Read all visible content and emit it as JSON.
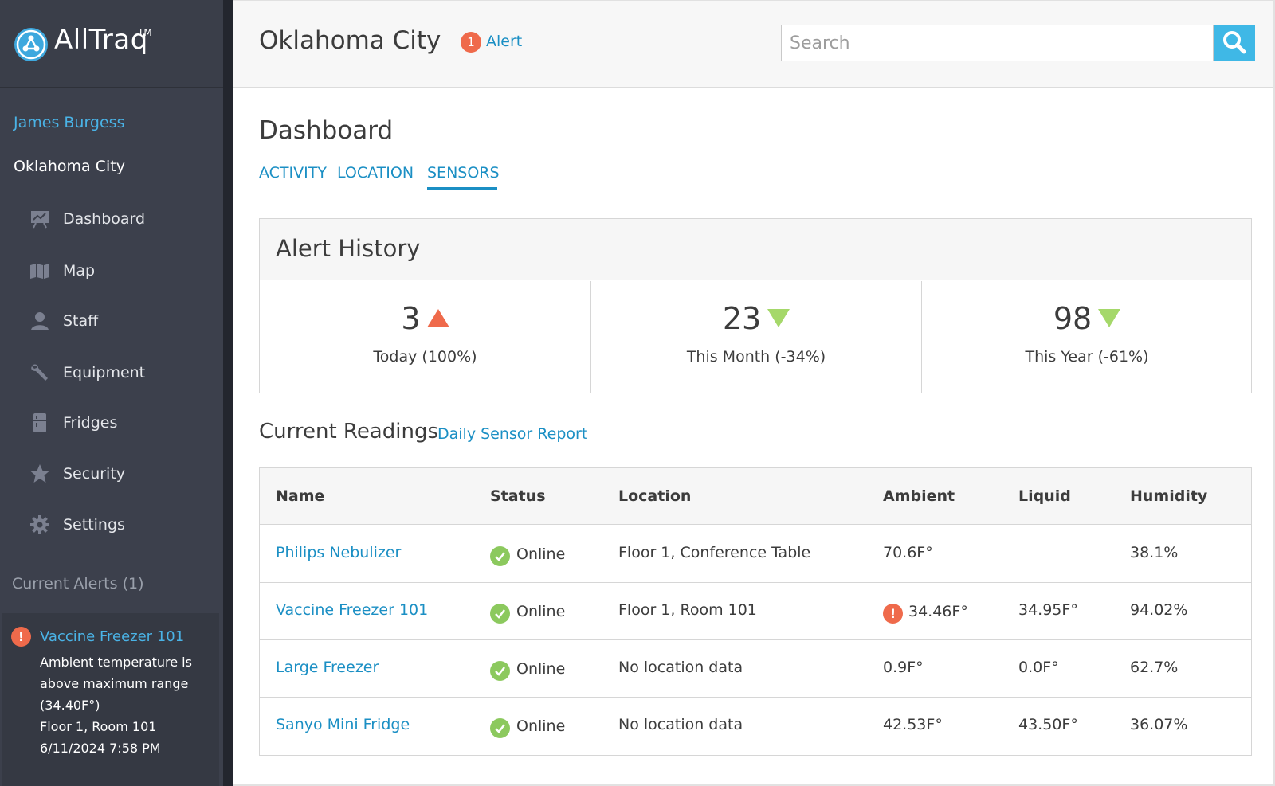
{
  "brand": {
    "name": "AllTraq",
    "tm": "TM",
    "icon": "alltraq-logo-icon"
  },
  "user": {
    "name": "James Burgess",
    "location": "Oklahoma City"
  },
  "nav": [
    {
      "label": "Dashboard",
      "icon": "dashboard-icon"
    },
    {
      "label": "Map",
      "icon": "map-icon"
    },
    {
      "label": "Staff",
      "icon": "person-icon"
    },
    {
      "label": "Equipment",
      "icon": "wrench-icon"
    },
    {
      "label": "Fridges",
      "icon": "fridge-icon"
    },
    {
      "label": "Security",
      "icon": "star-icon"
    },
    {
      "label": "Settings",
      "icon": "gear-icon"
    }
  ],
  "alerts_panel": {
    "title": "Current Alerts (1)",
    "items": [
      {
        "name": "Vaccine Freezer 101",
        "lines": [
          "Ambient temperature is",
          "above maximum range",
          "(34.40F°)",
          "Floor 1, Room 101",
          "6/11/2024 7:58 PM"
        ]
      }
    ]
  },
  "header": {
    "title": "Oklahoma City",
    "alert_count": "1",
    "alert_label": "Alert",
    "search_placeholder": "Search"
  },
  "dashboard": {
    "title": "Dashboard",
    "tabs": [
      "ACTIVITY",
      "LOCATION",
      "SENSORS"
    ],
    "active_tab": "SENSORS"
  },
  "alert_history": {
    "title": "Alert History",
    "stats": [
      {
        "value": "3",
        "trend": "up",
        "label": "Today (100%)"
      },
      {
        "value": "23",
        "trend": "down",
        "label": "This Month (-34%)"
      },
      {
        "value": "98",
        "trend": "down",
        "label": "This Year (-61%)"
      }
    ]
  },
  "readings": {
    "title": "Current Readings",
    "link": "Daily Sensor Report",
    "columns": [
      "Name",
      "Status",
      "Location",
      "Ambient",
      "Liquid",
      "Humidity"
    ],
    "rows": [
      {
        "name": "Philips Nebulizer",
        "status": "Online",
        "location": "Floor 1, Conference Table",
        "ambient": "70.6F°",
        "ambient_alert": false,
        "liquid": "",
        "humidity": "38.1%"
      },
      {
        "name": "Vaccine Freezer 101",
        "status": "Online",
        "location": "Floor 1, Room 101",
        "ambient": "34.46F°",
        "ambient_alert": true,
        "liquid": "34.95F°",
        "humidity": "94.02%"
      },
      {
        "name": "Large Freezer",
        "status": "Online",
        "location": "No location data",
        "ambient": "0.9F°",
        "ambient_alert": false,
        "liquid": "0.0F°",
        "humidity": "62.7%"
      },
      {
        "name": "Sanyo Mini Fridge",
        "status": "Online",
        "location": "No location data",
        "ambient": "42.53F°",
        "ambient_alert": false,
        "liquid": "43.50F°",
        "humidity": "36.07%"
      }
    ]
  },
  "colors": {
    "sidebar_bg": "#3c404c",
    "accent": "#1b8fc4",
    "search_button": "#3fb8e6",
    "alert_red": "#ef6a4b",
    "online_green": "#8cc95e",
    "trend_down": "#a5d86a"
  }
}
